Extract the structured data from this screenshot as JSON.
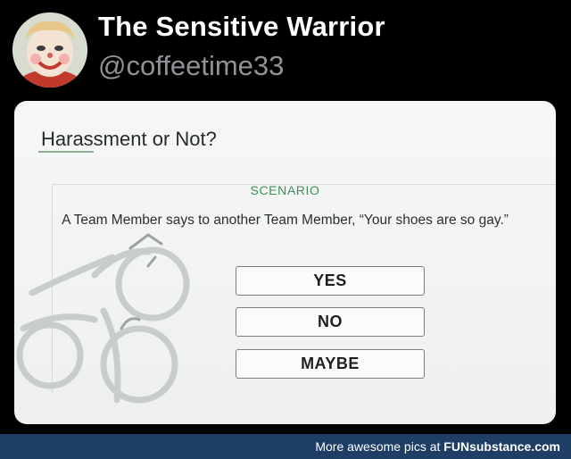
{
  "tweet": {
    "display_name": "The Sensitive Warrior",
    "handle": "@coffeetime33"
  },
  "card": {
    "title": "Harassment or Not?",
    "scenario_label": "SCENARIO",
    "scenario_text": "A Team Member says to another Team Member, “Your shoes are so gay.”",
    "answers": [
      "YES",
      "NO",
      "MAYBE"
    ]
  },
  "footer": {
    "text": "More awesome pics at ",
    "brand": "FUNsubstance.com"
  },
  "colors": {
    "background": "#000000",
    "scenario_label": "#3f8f55",
    "footer_bar": "#1e3e66"
  }
}
